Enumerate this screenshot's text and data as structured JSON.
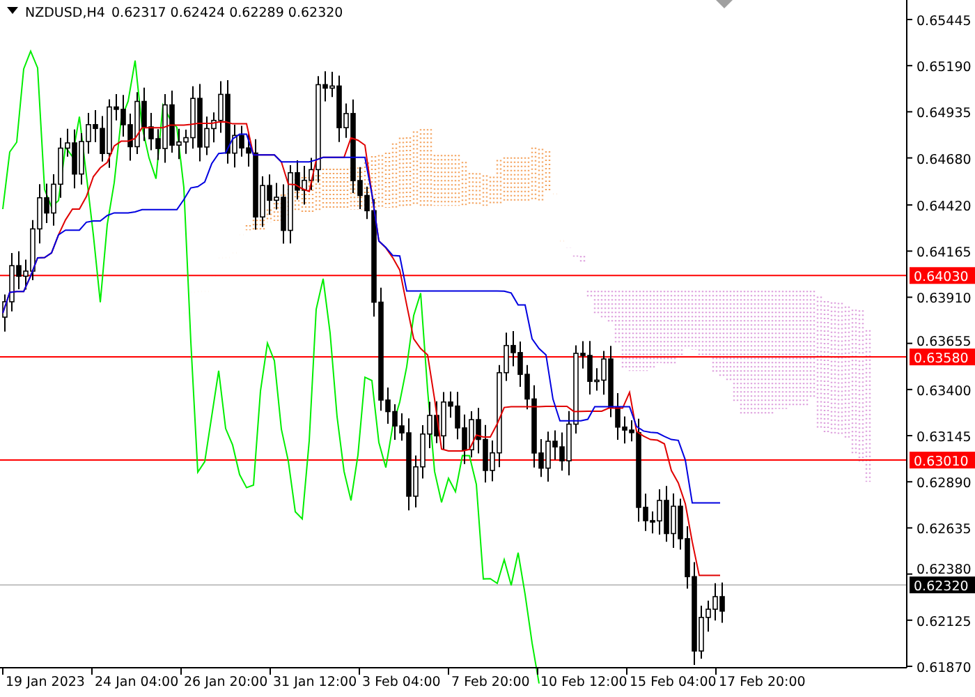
{
  "chart": {
    "symbol": "NZDUSD,H4",
    "quote": "0.62317 0.62424 0.62289 0.62320",
    "price_axis": [
      "0.65445",
      "0.65190",
      "0.64935",
      "0.64680",
      "0.64420",
      "0.64165",
      "0.63910",
      "0.63655",
      "0.63400",
      "0.63145",
      "0.62890",
      "0.62635",
      "0.62380",
      "0.62125",
      "0.61870"
    ],
    "time_axis": [
      "19 Jan 2023",
      "24 Jan 04:00",
      "26 Jan 20:00",
      "31 Jan 12:00",
      "3 Feb 04:00",
      "7 Feb 20:00",
      "10 Feb 12:00",
      "15 Feb 04:00",
      "17 Feb 20:00"
    ],
    "levels": [
      {
        "label": "0.64030",
        "kind": "alert",
        "color": "#ff0000"
      },
      {
        "label": "0.63580",
        "kind": "alert",
        "color": "#ff0000"
      },
      {
        "label": "0.63010",
        "kind": "alert",
        "color": "#ff0000"
      },
      {
        "label": "0.62320",
        "kind": "bid",
        "color": "#000000"
      }
    ]
  }
}
